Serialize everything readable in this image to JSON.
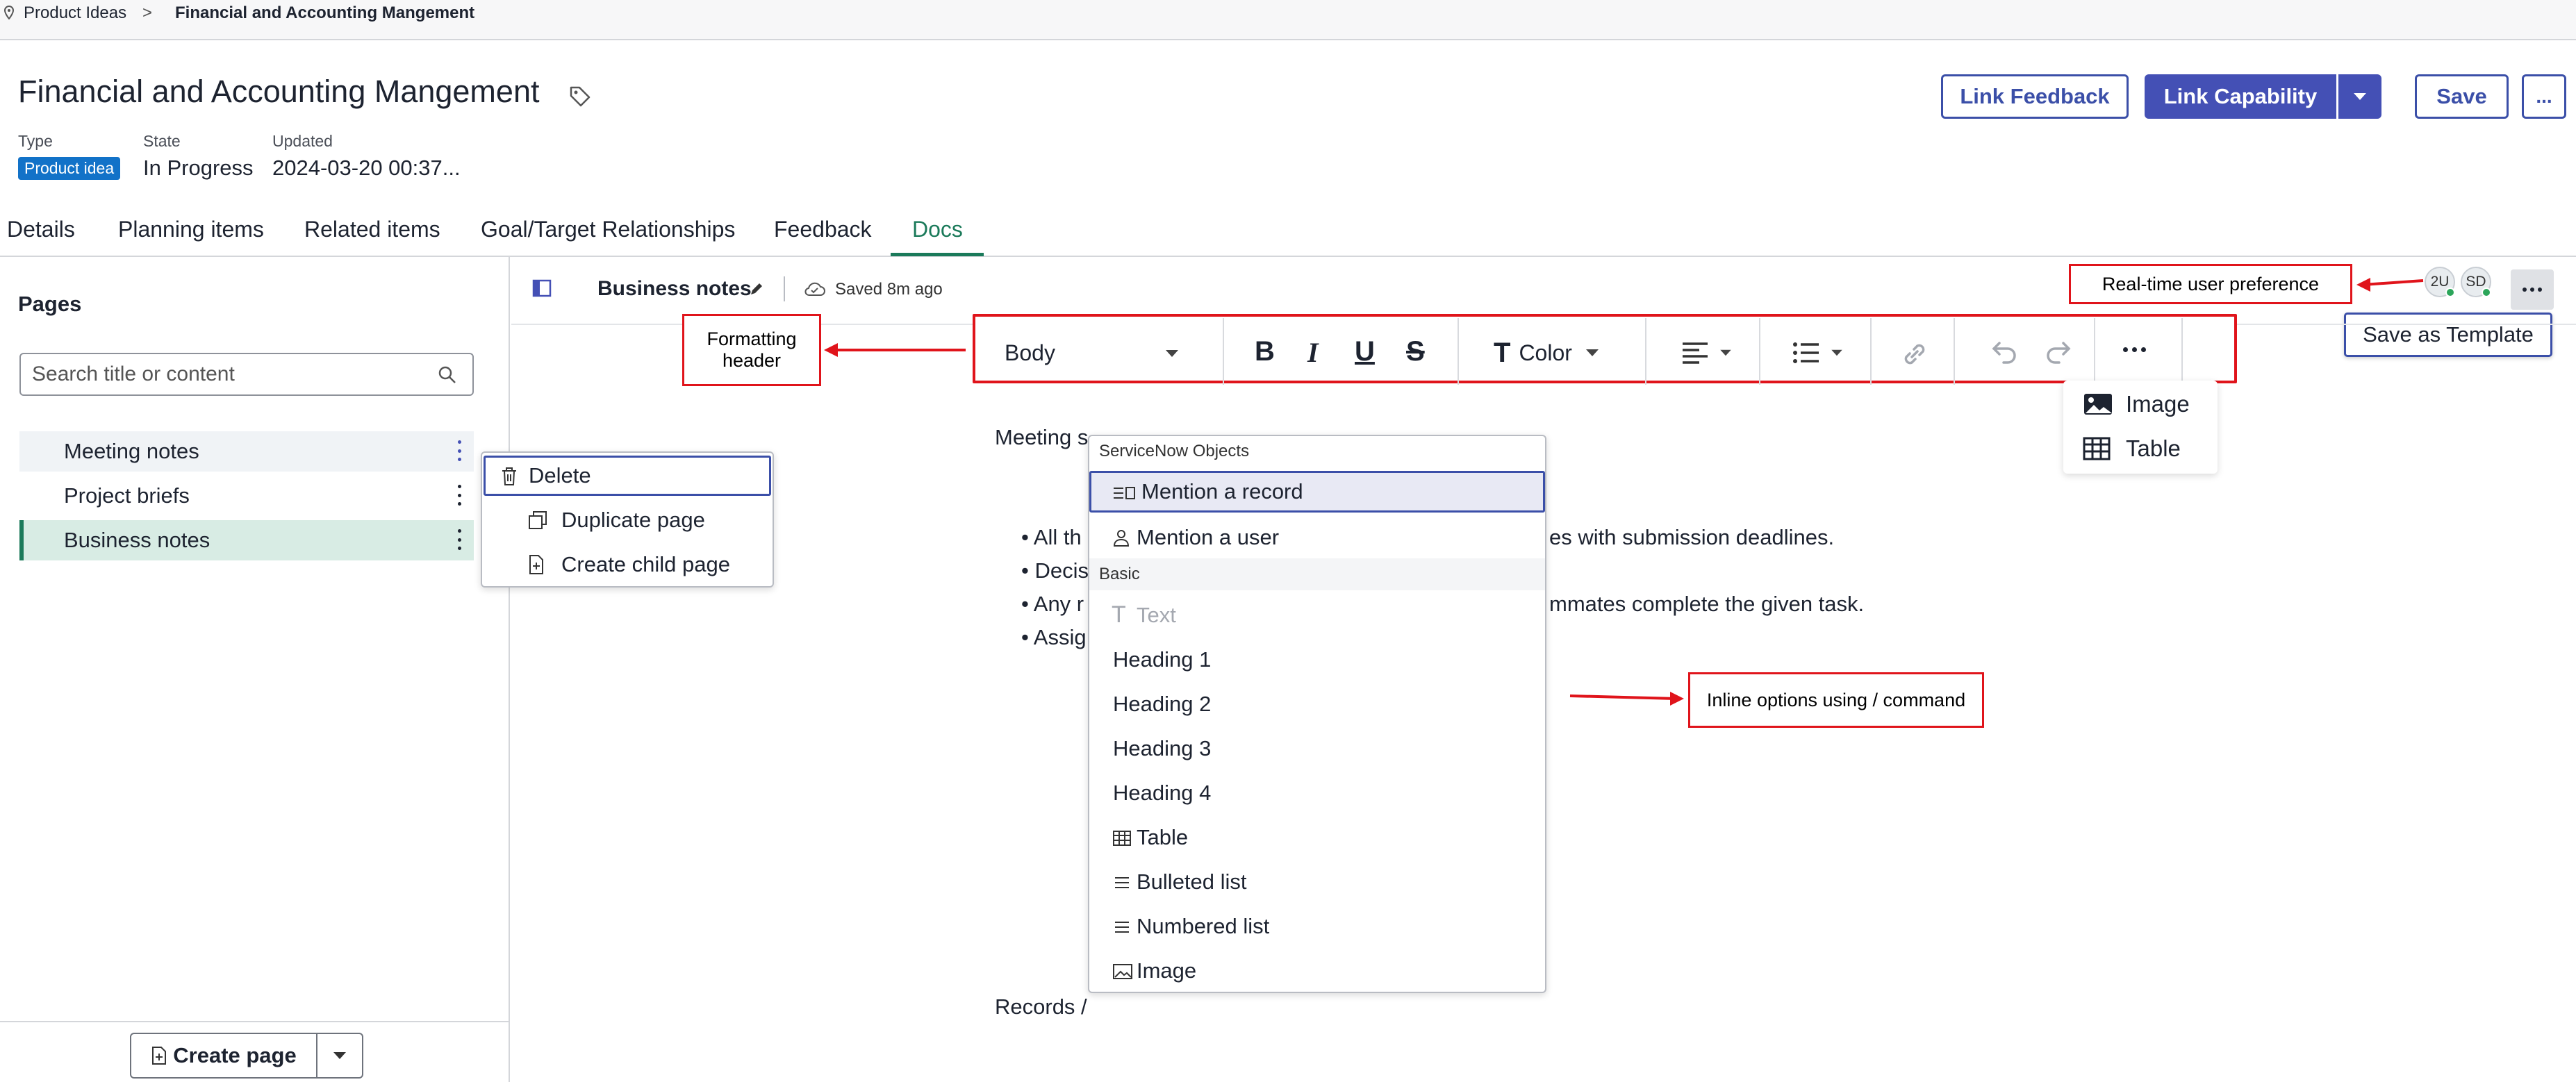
{
  "breadcrumb": {
    "root": "Product Ideas",
    "separator": ">",
    "current": "Financial and Accounting Mangement"
  },
  "header": {
    "title": "Financial and Accounting Mangement",
    "type_label": "Type",
    "type_value": "Product idea",
    "state_label": "State",
    "state_value": "In Progress",
    "updated_label": "Updated",
    "updated_value": "2024-03-20 00:37...",
    "link_feedback": "Link Feedback",
    "link_capability": "Link Capability",
    "save": "Save",
    "more": "..."
  },
  "tabs": [
    "Details",
    "Planning items",
    "Related items",
    "Goal/Target Relationships",
    "Feedback",
    "Docs"
  ],
  "active_tab": "Docs",
  "sidebar": {
    "title": "Pages",
    "search_placeholder": "Search title or content",
    "pages": [
      "Meeting notes",
      "Project briefs",
      "Business notes"
    ],
    "selected_page": "Business notes",
    "create_page": "Create page"
  },
  "page_menu": {
    "items": [
      "Delete",
      "Duplicate page",
      "Create child page"
    ]
  },
  "editor": {
    "doc_title": "Business notes",
    "saved": "Saved 8m ago",
    "avatars": [
      "2U",
      "SD"
    ],
    "save_as_template": "Save as Template",
    "toolbar": {
      "style": "Body",
      "color": "Color"
    },
    "insert_menu": [
      "Image",
      "Table"
    ],
    "content": {
      "heading_prefix": "Meeting s",
      "bullets": [
        {
          "left": "All th",
          "right": "es with submission deadlines."
        },
        {
          "left": "Decis",
          "right": ""
        },
        {
          "left": "Any r",
          "right": "mmates complete the given task."
        },
        {
          "left": "Assig",
          "right": ""
        }
      ],
      "command_line": "Records /"
    }
  },
  "slash_menu": {
    "section1": "ServiceNow Objects",
    "objects": [
      "Mention a record",
      "Mention a user"
    ],
    "section2": "Basic",
    "basic": [
      "Text",
      "Heading 1",
      "Heading 2",
      "Heading 3",
      "Heading 4",
      "Table",
      "Bulleted list",
      "Numbered list",
      "Image"
    ]
  },
  "annotations": {
    "formatting": "Formatting header",
    "realtime": "Real-time user preference",
    "inline": "Inline options using / command"
  },
  "colors": {
    "brand": "#4450b5",
    "accent_green": "#1b7a5a",
    "annotation": "#e0141b",
    "badge": "#1272c8"
  }
}
